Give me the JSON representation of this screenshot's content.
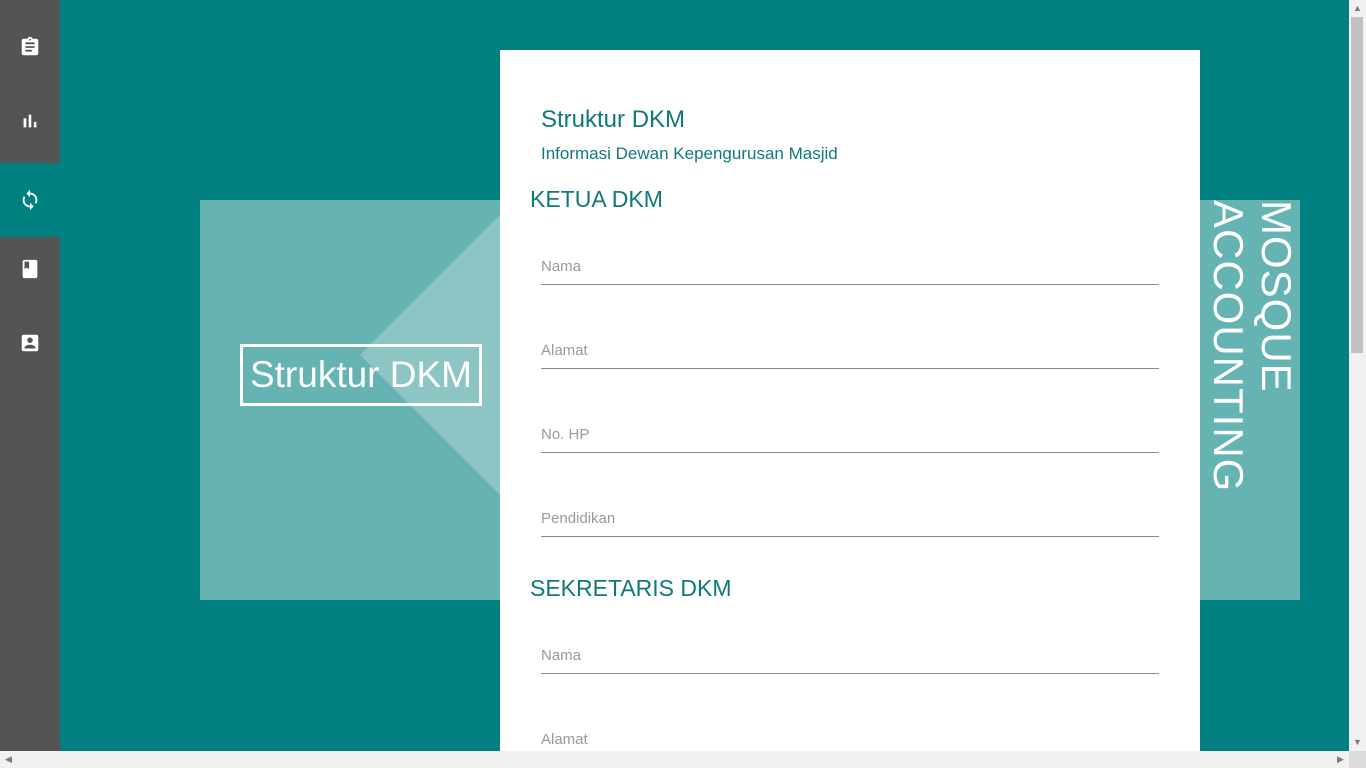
{
  "sidebar": {
    "items": [
      {
        "icon": "clipboard-icon",
        "active": false
      },
      {
        "icon": "bar-chart-icon",
        "active": false
      },
      {
        "icon": "sync-icon",
        "active": true
      },
      {
        "icon": "book-icon",
        "active": false
      },
      {
        "icon": "contact-card-icon",
        "active": false
      }
    ]
  },
  "hero": {
    "title": "Struktur DKM"
  },
  "brand": {
    "line1": "MOSQUE",
    "line2": "ACCOUNTING"
  },
  "card": {
    "title": "Struktur DKM",
    "subtitle": "Informasi Dewan Kepengurusan Masjid",
    "sections": [
      {
        "heading": "KETUA DKM",
        "fields": [
          {
            "placeholder": "Nama",
            "value": ""
          },
          {
            "placeholder": "Alamat",
            "value": ""
          },
          {
            "placeholder": "No. HP",
            "value": ""
          },
          {
            "placeholder": "Pendidikan",
            "value": ""
          }
        ]
      },
      {
        "heading": "SEKRETARIS DKM",
        "fields": [
          {
            "placeholder": "Nama",
            "value": ""
          },
          {
            "placeholder": "Alamat",
            "value": ""
          }
        ]
      }
    ]
  },
  "colors": {
    "background": "#008080",
    "sidebar": "#545454",
    "panel": "#66b3b3",
    "accent_text": "#0f7a7a"
  }
}
